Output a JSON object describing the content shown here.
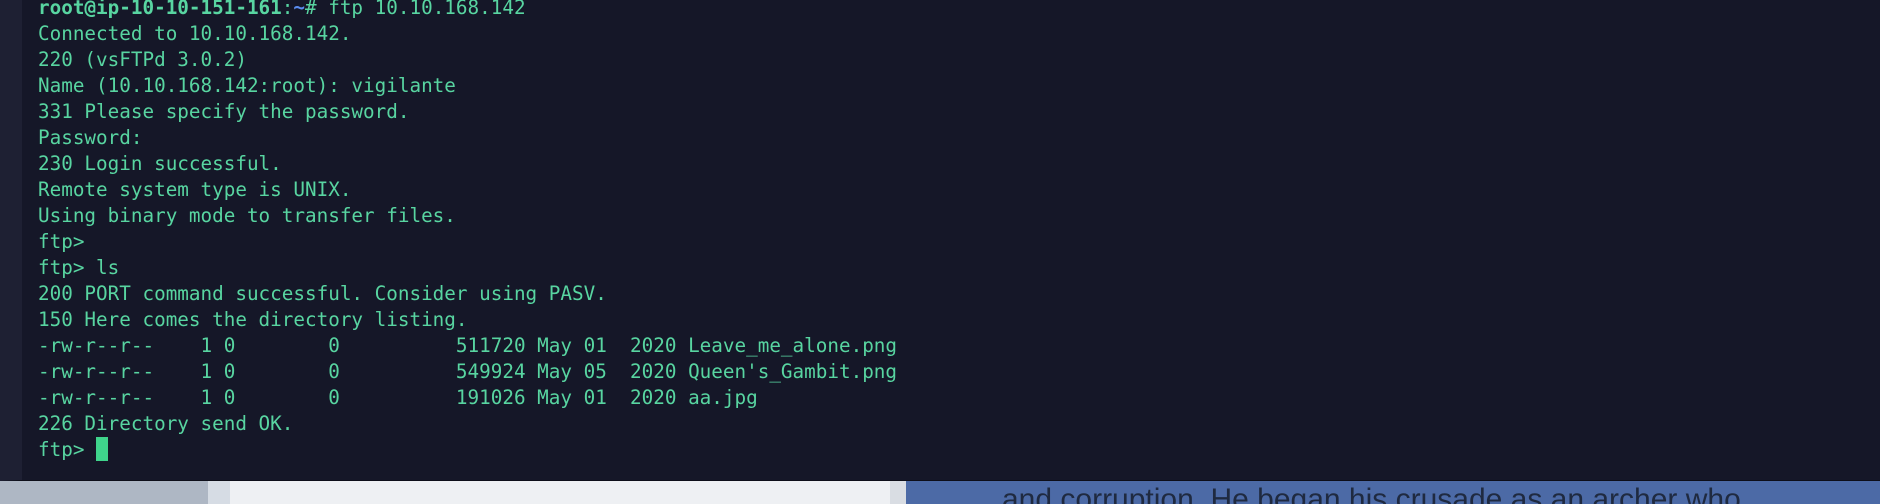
{
  "terminal": {
    "prompt": {
      "user_host": "root@ip-10-10-151-161",
      "path": "~",
      "symbol": "# ",
      "command": "ftp 10.10.168.142"
    },
    "lines": [
      "Connected to 10.10.168.142.",
      "220 (vsFTPd 3.0.2)",
      "Name (10.10.168.142:root): vigilante",
      "331 Please specify the password.",
      "Password:",
      "230 Login successful.",
      "Remote system type is UNIX.",
      "Using binary mode to transfer files.",
      "ftp>",
      "ftp> ls",
      "200 PORT command successful. Consider using PASV.",
      "150 Here comes the directory listing.",
      "-rw-r--r--    1 0        0          511720 May 01  2020 Leave_me_alone.png",
      "-rw-r--r--    1 0        0          549924 May 05  2020 Queen's_Gambit.png",
      "-rw-r--r--    1 0        0          191026 May 01  2020 aa.jpg",
      "226 Directory send OK."
    ],
    "final_prompt": "ftp> "
  },
  "background": {
    "text": "and corruption. He began his crusade as an archer who"
  },
  "colors": {
    "terminal_bg": "#151728",
    "text": "#58d5a1",
    "path": "#5b8df0",
    "cursor": "#3fd48c"
  }
}
